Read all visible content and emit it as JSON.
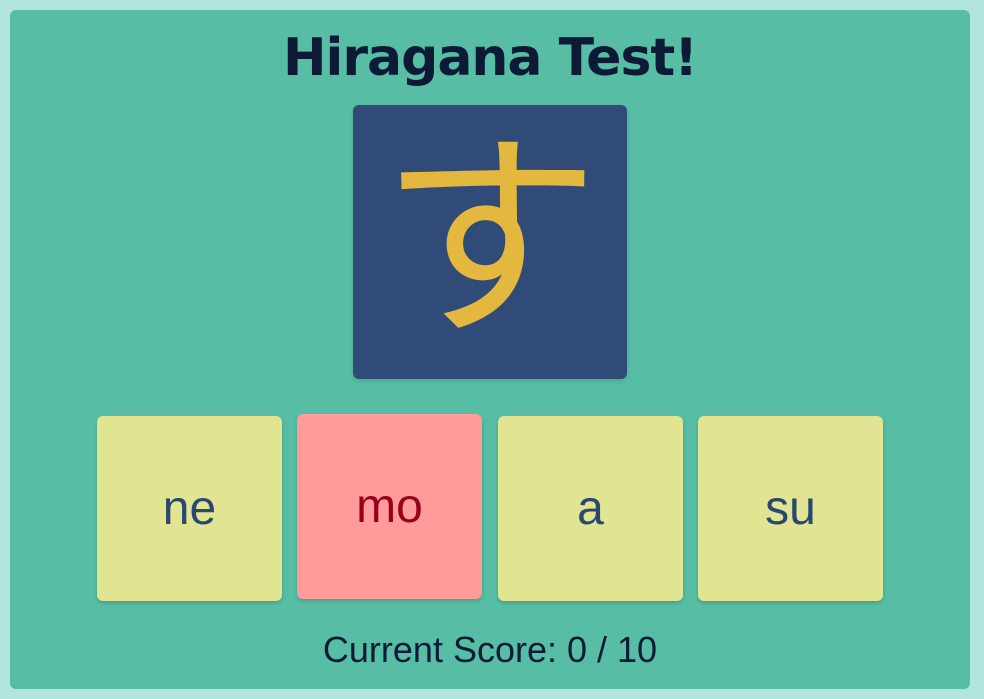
{
  "title": "Hiragana Test!",
  "question": {
    "character": "す"
  },
  "options": [
    {
      "label": "ne",
      "state": "normal"
    },
    {
      "label": "mo",
      "state": "wrong"
    },
    {
      "label": "a",
      "state": "normal"
    },
    {
      "label": "su",
      "state": "normal"
    }
  ],
  "score": {
    "text": "Current Score: 0 / 10"
  },
  "colors": {
    "page_background": "#b2e6dc",
    "panel_background": "#57bea5",
    "card_background": "#304b78",
    "character_color": "#e4b73e",
    "option_background": "#e1e591",
    "option_text": "#2c4672",
    "wrong_background": "#ff9b9b",
    "wrong_text": "#98001a",
    "title_text": "#0d1a36"
  }
}
